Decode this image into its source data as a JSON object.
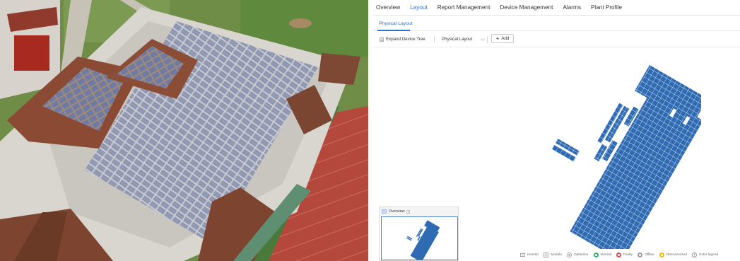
{
  "nav": {
    "items": [
      "Overview",
      "Layout",
      "Report Management",
      "Device Management",
      "Alarms",
      "Plant Profile"
    ],
    "active_index": 1
  },
  "subtabs": {
    "active": "Physical Layout"
  },
  "toolbar": {
    "expand_label": "Expand Device Tree",
    "layout_select_value": "Physical Layout",
    "add_label": "Add"
  },
  "overview": {
    "title": "Overview"
  },
  "legend": [
    {
      "label": "Inverter",
      "icon": "inverter-icon",
      "color": "#777777"
    },
    {
      "label": "Module",
      "icon": "module-icon",
      "color": "#777777"
    },
    {
      "label": "Optimizer",
      "icon": "optimizer-icon",
      "color": "#777777"
    },
    {
      "label": "Normal",
      "icon": "normal-status-icon",
      "color": "#2fb36b"
    },
    {
      "label": "Faulty",
      "icon": "faulty-status-icon",
      "color": "#e04848"
    },
    {
      "label": "Offline",
      "icon": "offline-status-icon",
      "color": "#9a9a9a"
    },
    {
      "label": "Disconnected",
      "icon": "disconnected-status-icon",
      "color": "#f0b61a"
    },
    {
      "label": "Color legend",
      "icon": "color-legend-icon",
      "color": "#555555"
    }
  ],
  "colors": {
    "accent": "#2f6fd1",
    "panel_fill": "#2f6bb3",
    "panel_stroke": "#ffffff"
  }
}
